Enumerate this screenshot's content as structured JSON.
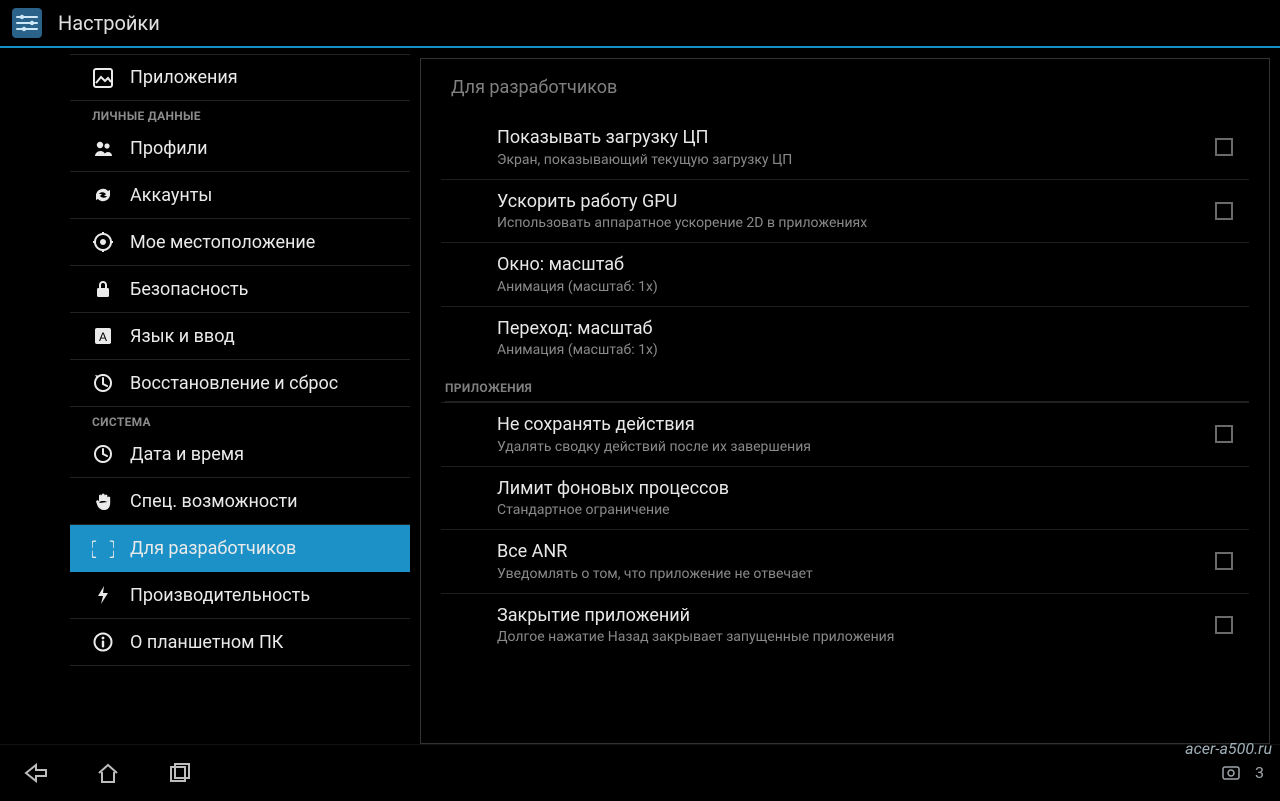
{
  "titlebar": {
    "title": "Настройки"
  },
  "sidebar": {
    "items": [
      {
        "label": "Приложения",
        "icon": "apps-icon",
        "head": null,
        "active": false
      },
      {
        "label": "ЛИЧНЫЕ ДАННЫЕ",
        "head": true
      },
      {
        "label": "Профили",
        "icon": "profiles-icon",
        "active": false
      },
      {
        "label": "Аккаунты",
        "icon": "sync-icon",
        "active": false
      },
      {
        "label": "Мое местоположение",
        "icon": "location-icon",
        "active": false
      },
      {
        "label": "Безопасность",
        "icon": "lock-icon",
        "active": false
      },
      {
        "label": "Язык и ввод",
        "icon": "language-icon",
        "active": false
      },
      {
        "label": "Восстановление и сброс",
        "icon": "backup-icon",
        "active": false
      },
      {
        "label": "СИСТЕМА",
        "head": true
      },
      {
        "label": "Дата и время",
        "icon": "clock-icon",
        "active": false
      },
      {
        "label": "Спец. возможности",
        "icon": "hand-icon",
        "active": false
      },
      {
        "label": "Для разработчиков",
        "icon": "braces-icon",
        "active": true
      },
      {
        "label": "Производительность",
        "icon": "bolt-icon",
        "active": false
      },
      {
        "label": "О планшетном ПК",
        "icon": "info-icon",
        "active": false
      }
    ]
  },
  "right": {
    "title": "Для разработчиков",
    "groups": [
      {
        "header": null,
        "items": [
          {
            "title": "Показывать загрузку ЦП",
            "sub": "Экран, показывающий текущую загрузку ЦП",
            "checkbox": true
          },
          {
            "title": "Ускорить работу GPU",
            "sub": "Использовать аппаратное ускорение 2D в приложениях",
            "checkbox": true
          },
          {
            "title": "Окно: масштаб",
            "sub": "Анимация (масштаб: 1х)",
            "checkbox": false
          },
          {
            "title": "Переход: масштаб",
            "sub": "Анимация (масштаб: 1х)",
            "checkbox": false
          }
        ]
      },
      {
        "header": "ПРИЛОЖЕНИЯ",
        "items": [
          {
            "title": "Не сохранять действия",
            "sub": "Удалять сводку действий после их завершения",
            "checkbox": true
          },
          {
            "title": "Лимит фоновых процессов",
            "sub": "Стандартное ограничение",
            "checkbox": false
          },
          {
            "title": "Все ANR",
            "sub": "Уведомлять о том, что приложение не отвечает",
            "checkbox": true
          },
          {
            "title": "Закрытие приложений",
            "sub": "Долгое нажатие Назад закрывает запущенные приложения",
            "checkbox": true
          }
        ]
      }
    ]
  },
  "tray": {
    "time": "3"
  },
  "watermark": "acer-a500.ru"
}
